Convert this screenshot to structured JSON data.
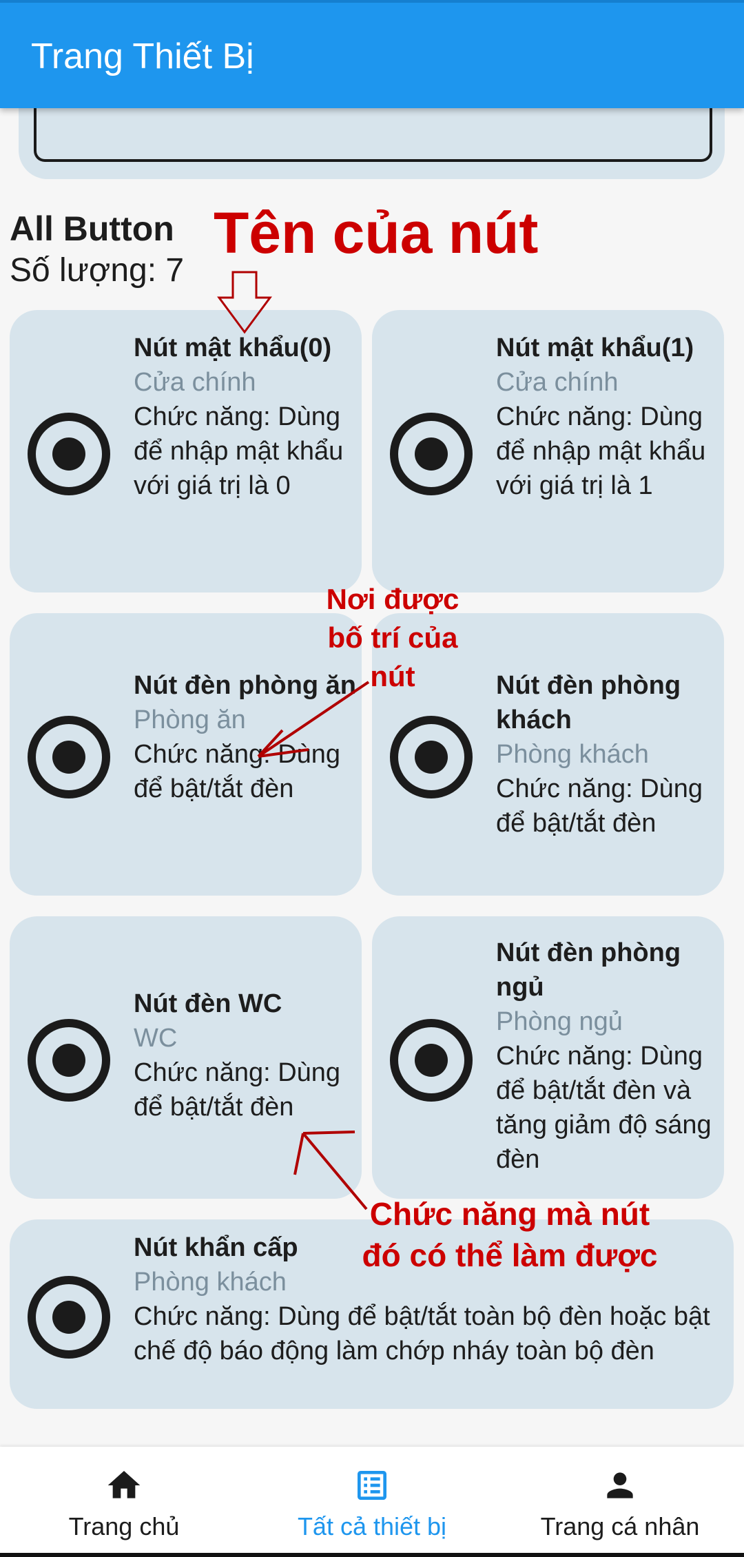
{
  "app": {
    "title": "Trang Thiết Bị"
  },
  "section": {
    "title": "All Button",
    "count_text": "Số lượng: 7"
  },
  "buttons": [
    {
      "name": "Nút mật khẩu(0)",
      "location": "Cửa chính",
      "function": "Chức năng: Dùng để nhập mật khẩu với giá trị là 0"
    },
    {
      "name": "Nút mật khẩu(1)",
      "location": "Cửa chính",
      "function": "Chức năng: Dùng để nhập mật khẩu với giá trị là 1"
    },
    {
      "name": "Nút đèn phòng ăn",
      "location": "Phòng ăn",
      "function": "Chức năng: Dùng để bật/tắt đèn"
    },
    {
      "name": "Nút đèn phòng khách",
      "location": "Phòng khách",
      "function": "Chức năng: Dùng để bật/tắt đèn"
    },
    {
      "name": "Nút đèn WC",
      "location": "WC",
      "function": "Chức năng: Dùng để bật/tắt đèn"
    },
    {
      "name": "Nút đèn phòng ngủ",
      "location": "Phòng ngủ",
      "function": "Chức năng: Dùng để bật/tắt đèn và tăng giảm độ sáng đèn"
    },
    {
      "name": "Nút khẩn cấp",
      "location": "Phòng khách",
      "function": "Chức năng: Dùng để bật/tắt toàn bộ đèn hoặc bật chế độ báo động làm chớp nháy toàn bộ đèn"
    }
  ],
  "annotations": {
    "name_label": "Tên của nút",
    "location_label": "Nơi được bố trí của nút",
    "function_label": "Chức năng mà nút đó có thể làm được"
  },
  "bottom_nav": [
    {
      "label": "Trang chủ",
      "icon": "home-icon",
      "active": false
    },
    {
      "label": "Tất cả thiết bị",
      "icon": "list-icon",
      "active": true
    },
    {
      "label": "Trang cá nhân",
      "icon": "person-icon",
      "active": false
    }
  ],
  "colors": {
    "primary": "#1e96ee",
    "card": "#d7e4ec",
    "annotation": "#cc0000",
    "location_text": "#7b8f9d"
  }
}
